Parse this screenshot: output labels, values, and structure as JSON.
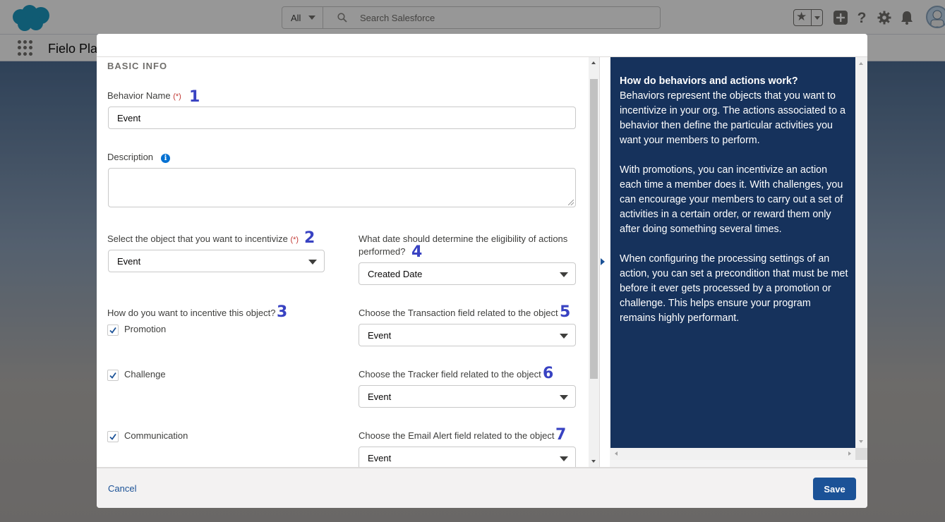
{
  "header": {
    "search_scope": "All",
    "search_placeholder": "Search Salesforce",
    "app_name": "Fielo Pla"
  },
  "colors": {
    "brand_blue": "#1b5297",
    "help_panel_bg": "#16325c",
    "annotation_number": "#3842c2",
    "required": "#c23934",
    "info_icon": "#0070d2"
  },
  "form": {
    "section_title": "BASIC INFO",
    "required_marker": "(*)",
    "behavior_name": {
      "label": "Behavior Name",
      "value": "Event",
      "marker": "1"
    },
    "description": {
      "label": "Description",
      "value": ""
    },
    "object_select": {
      "label": "Select the object that you want to incentivize",
      "value": "Event",
      "marker": "2"
    },
    "date_select": {
      "label_line1": "What date should determine the eligibility of actions",
      "label_line2": "performed?",
      "value": "Created Date",
      "marker": "4"
    },
    "incentive": {
      "label": "How do you want to incentive this object?",
      "marker": "3",
      "options": [
        {
          "label": "Promotion",
          "checked": true
        },
        {
          "label": "Challenge",
          "checked": true
        },
        {
          "label": "Communication",
          "checked": true
        }
      ]
    },
    "transaction_select": {
      "label": "Choose the Transaction field related to the object",
      "value": "Event",
      "marker": "5"
    },
    "tracker_select": {
      "label": "Choose the Tracker field related to the object",
      "value": "Event",
      "marker": "6"
    },
    "email_select": {
      "label": "Choose the Email Alert field related to the object",
      "value": "Event",
      "marker": "7"
    }
  },
  "help": {
    "title": "How do behaviors and actions work?",
    "p1": "Behaviors represent the objects that you want to incentivize in your org. The actions associated to a behavior then define the particular activities you want your members to perform.",
    "p2": "With promotions, you can incentivize an action each time a member does it. With challenges, you can encourage your members to carry out a set of activities in a certain order, or reward them only after doing something several times.",
    "p3": "When configuring the processing settings of an action, you can set a precondition that must be met before it ever gets processed by a promotion or challenge. This helps ensure your program remains highly performant."
  },
  "footer": {
    "cancel_label": "Cancel",
    "save_label": "Save"
  }
}
